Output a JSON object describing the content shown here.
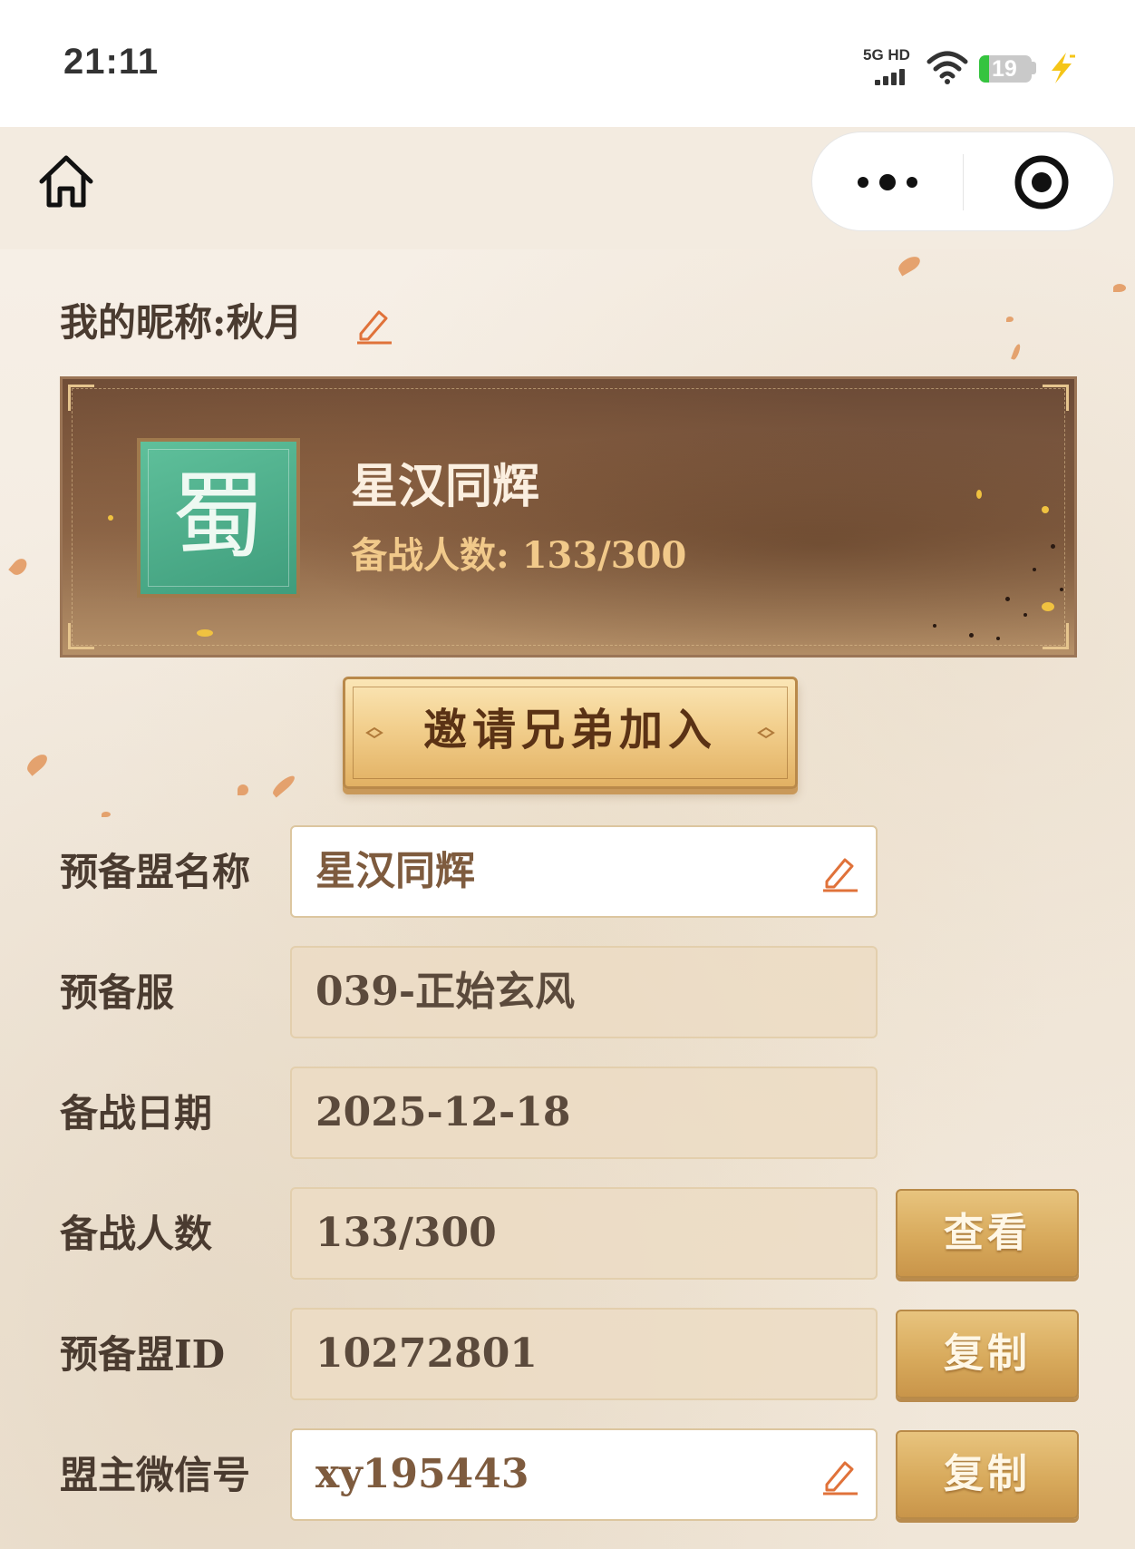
{
  "status_bar": {
    "time": "21:11",
    "network": "5G HD",
    "battery": "19",
    "battery_level_pct": 19,
    "icons": [
      "signal-icon",
      "wifi-icon",
      "battery-icon",
      "charging-icon"
    ]
  },
  "nav": {
    "icons": [
      "home-icon",
      "more-icon",
      "target-icon"
    ]
  },
  "profile": {
    "label": "我的昵称:",
    "name": "秋月"
  },
  "alliance_card": {
    "emblem_char": "蜀",
    "name": "星汉同辉",
    "count_text": "备战人数: 133/300"
  },
  "invite_button": {
    "label": "邀请兄弟加入"
  },
  "form": {
    "fields": [
      {
        "label": "预备盟名称",
        "value": "星汉同辉",
        "editable": true
      },
      {
        "label": "预备服",
        "value": "039-正始玄风",
        "editable": false
      },
      {
        "label": "备战日期",
        "value": "2025-12-18",
        "editable": false
      },
      {
        "label": "备战人数",
        "value": "133/300",
        "editable": false,
        "action": "查看"
      },
      {
        "label": "预备盟ID",
        "value": "10272801",
        "editable": false,
        "action": "复制"
      },
      {
        "label": "盟主微信号",
        "value": "xy195443",
        "editable": true,
        "action": "复制"
      }
    ]
  },
  "colors": {
    "label_text": "#4a3b30",
    "gold_button": "#d8aa5c",
    "emblem_green": "#4fae8a",
    "banner_brown": "#7a5640"
  }
}
